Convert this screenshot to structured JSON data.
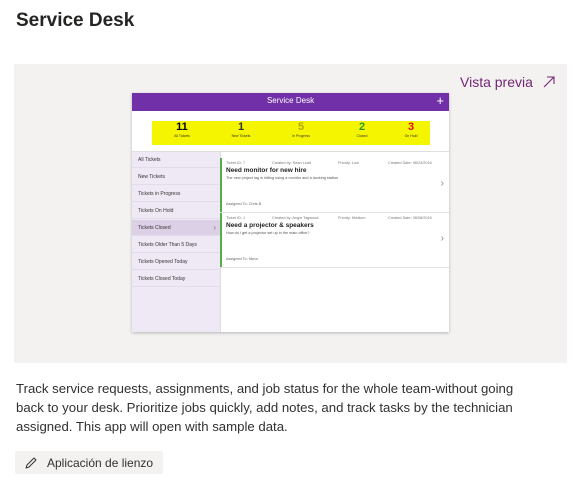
{
  "page": {
    "title": "Service Desk",
    "preview_link": "Vista previa"
  },
  "app": {
    "title": "Service Desk",
    "add_symbol": "+",
    "stats": [
      {
        "value": "11",
        "label": "All Tickets",
        "color": "#000000"
      },
      {
        "value": "1",
        "label": "New Tickets",
        "color": "#333333"
      },
      {
        "value": "5",
        "label": "In Progress",
        "color": "#b5a800"
      },
      {
        "value": "2",
        "label": "Closed",
        "color": "#2a9d2a"
      },
      {
        "value": "3",
        "label": "On Hold",
        "color": "#e01010"
      }
    ],
    "sidebar": [
      "All Tickets",
      "New Tickets",
      "Tickets in Progress",
      "Tickets On Hold",
      "Tickets Closed",
      "Tickets Older Than 5 Days",
      "Tickets Opened Today",
      "Tickets Closed Today"
    ],
    "active_sidebar_index": 4,
    "tickets": [
      {
        "id": "Ticket ID: 7",
        "created_by": "Created by: Sean Lodd",
        "priority": "Priority: Low",
        "created_date": "Created Date: 08/23/2016",
        "title": "Need monitor for new hire",
        "description": "The new project lag is hitting using a monitor and a docking station",
        "assigned": "Assigned To: Chris B"
      },
      {
        "id": "Ticket ID: 1",
        "created_by": "Created by: Angie Tagwood",
        "priority": "Priority: Medium",
        "created_date": "Created Date: 08/08/2016",
        "title": "Need a projector & speakers",
        "description": "How do I get a projector set up in the main office?",
        "assigned": "Assigned To: Nima"
      }
    ]
  },
  "description": "Track service requests, assignments, and job status for the whole team-without going back to your desk. Prioritize jobs quickly, add notes, and track tasks by the technician assigned. This app will open with sample data.",
  "chip": {
    "label": "Aplicación de lienzo",
    "icon": "pen-icon"
  },
  "colors": {
    "accent": "#742774",
    "header": "#7230a8",
    "highlight": "#f5f500",
    "ticket_bar": "#53b047"
  }
}
